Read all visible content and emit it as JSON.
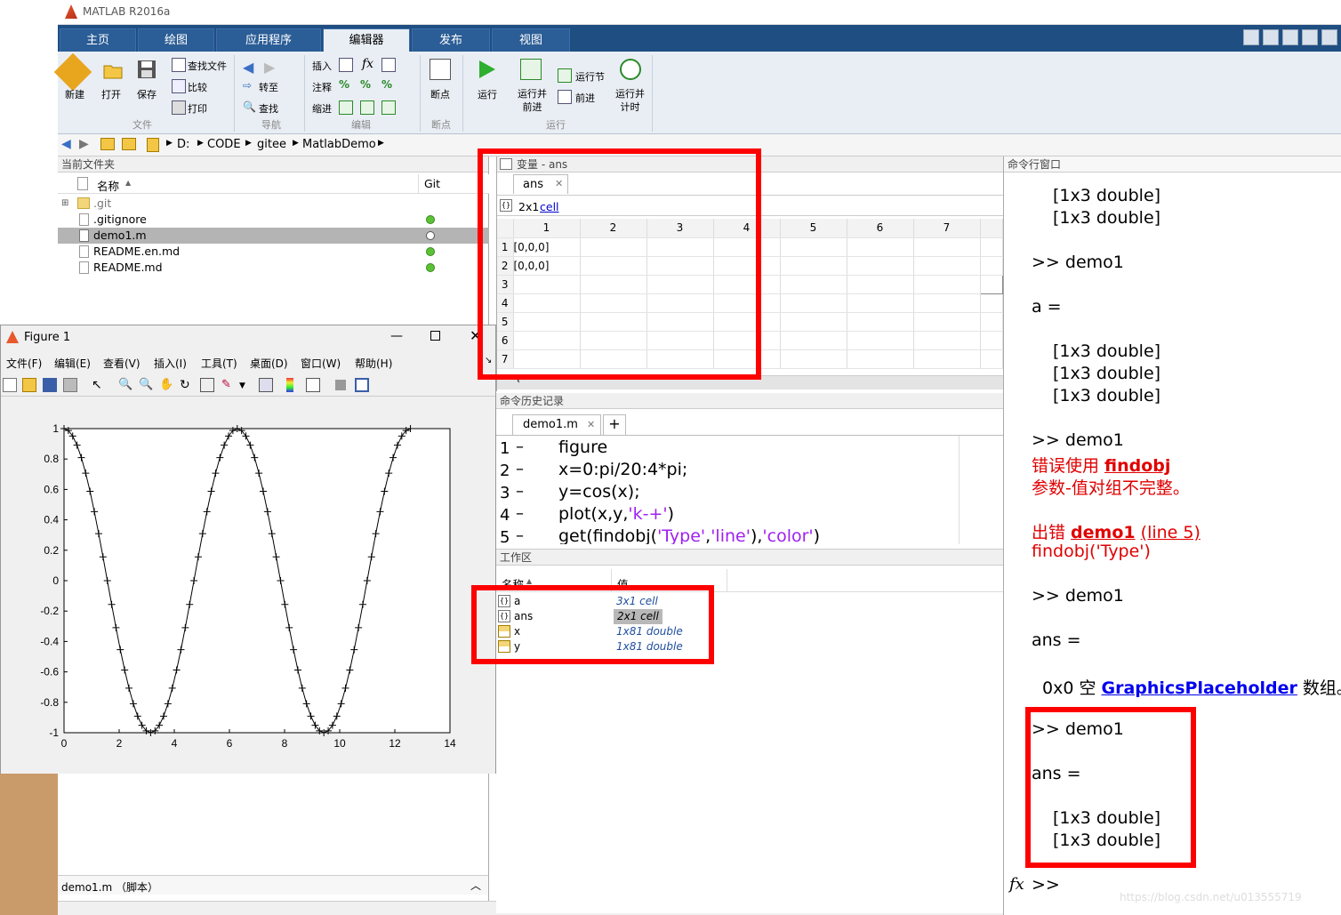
{
  "app": {
    "title": "MATLAB R2016a"
  },
  "tabs": [
    {
      "label": "主页"
    },
    {
      "label": "绘图"
    },
    {
      "label": "应用程序"
    },
    {
      "label": "编辑器"
    },
    {
      "label": "发布"
    },
    {
      "label": "视图"
    }
  ],
  "ribbon": {
    "new": "新建",
    "open": "打开",
    "save": "保存",
    "find_files": "查找文件",
    "compare": "比较",
    "print": "打印",
    "group_file": "文件",
    "goto": "转至",
    "find": "查找",
    "group_nav": "导航",
    "insert": "插入",
    "fx": "fx",
    "comment": "注释",
    "indent": "缩进",
    "group_edit": "编辑",
    "breakpoint": "断点",
    "group_break": "断点",
    "run": "运行",
    "run_advance": "运行并\n前进",
    "run_section": "运行节",
    "advance": "前进",
    "run_time": "运行并\n计时",
    "group_run": "运行"
  },
  "address": {
    "segments": [
      "D:",
      "CODE",
      "gitee",
      "MatlabDemo"
    ]
  },
  "current_folder": {
    "title": "当前文件夹",
    "col_name": "名称",
    "col_git": "Git",
    "files": [
      {
        "name": ".git",
        "git": ""
      },
      {
        "name": ".gitignore",
        "git": "green"
      },
      {
        "name": "demo1.m",
        "git": "hollow"
      },
      {
        "name": "README.en.md",
        "git": "green"
      },
      {
        "name": "README.md",
        "git": "green"
      }
    ],
    "footer": "demo1.m （脚本）"
  },
  "figure": {
    "title": "Figure 1",
    "menu": [
      "文件(F)",
      "编辑(E)",
      "查看(V)",
      "插入(I)",
      "工具(T)",
      "桌面(D)",
      "窗口(W)",
      "帮助(H)"
    ]
  },
  "chart_data": {
    "type": "line",
    "title": "",
    "xlabel": "",
    "ylabel": "",
    "xlim": [
      0,
      14
    ],
    "ylim": [
      -1,
      1
    ],
    "xticks": [
      "0",
      "2",
      "4",
      "6",
      "8",
      "10",
      "12",
      "14"
    ],
    "yticks": [
      "1",
      "0.8",
      "0.6",
      "0.4",
      "0.2",
      "0",
      "-0.2",
      "-0.4",
      "-0.6",
      "-0.8",
      "-1"
    ],
    "series": [
      {
        "function": "y=cos(x)",
        "x_start": 0,
        "x_step": 0.15708,
        "count": 81,
        "style": "k-+",
        "color": "#000000"
      }
    ]
  },
  "variables": {
    "title": "变量 - ans",
    "tab": "ans",
    "info_size": "2x1",
    "info_link": "cell",
    "cols": [
      "1",
      "2",
      "3",
      "4",
      "5",
      "6",
      "7"
    ],
    "rows": [
      {
        "n": "1",
        "v": "[0,0,0]"
      },
      {
        "n": "2",
        "v": "[0,0,0]"
      },
      {
        "n": "3",
        "v": ""
      },
      {
        "n": "4",
        "v": ""
      },
      {
        "n": "5",
        "v": ""
      },
      {
        "n": "6",
        "v": ""
      },
      {
        "n": "7",
        "v": ""
      }
    ]
  },
  "history": {
    "title": "命令历史记录",
    "tab": "demo1.m",
    "lines": [
      {
        "n": "1",
        "code": "figure"
      },
      {
        "n": "2",
        "code": "x=0:pi/20:4*pi;"
      },
      {
        "n": "3",
        "code": "y=cos(x);"
      },
      {
        "n": "4",
        "code": "plot(x,y,'k-+')"
      },
      {
        "n": "5",
        "code": "get(findobj('Type','line'),'color')"
      }
    ]
  },
  "workspace": {
    "title": "工作区",
    "col_name": "名称",
    "col_value": "值",
    "vars": [
      {
        "name": "a",
        "value": "3x1 cell"
      },
      {
        "name": "ans",
        "value": "2x1 cell"
      },
      {
        "name": "x",
        "value": "1x81 double"
      },
      {
        "name": "y",
        "value": "1x81 double"
      }
    ]
  },
  "command": {
    "title": "命令行窗口",
    "l1": "[1x3 double]",
    "l2": "[1x3 double]",
    "p1": ">> demo1",
    "a_eq": "a =",
    "l3": "[1x3 double]",
    "l4": "[1x3 double]",
    "l5": "[1x3 double]",
    "p2": ">> demo1",
    "err1": "错误使用 ",
    "err1_link": "findobj",
    "err2": "参数-值对组不完整。",
    "err3": "出错 ",
    "err3_link": "demo1",
    "err3_line": "(line 5)",
    "err4": "findobj('Type')",
    "p3": ">> demo1",
    "ans_eq": "ans =",
    "empty1": "0x0 空 ",
    "empty_link": "GraphicsPlaceholder",
    "empty2": " 数组。",
    "p4": ">> demo1",
    "ans_eq2": "ans =",
    "l6": "[1x3 double]",
    "l7": "[1x3 double]",
    "prompt": ">>",
    "watermark": "https://blog.csdn.net/u013555719"
  }
}
